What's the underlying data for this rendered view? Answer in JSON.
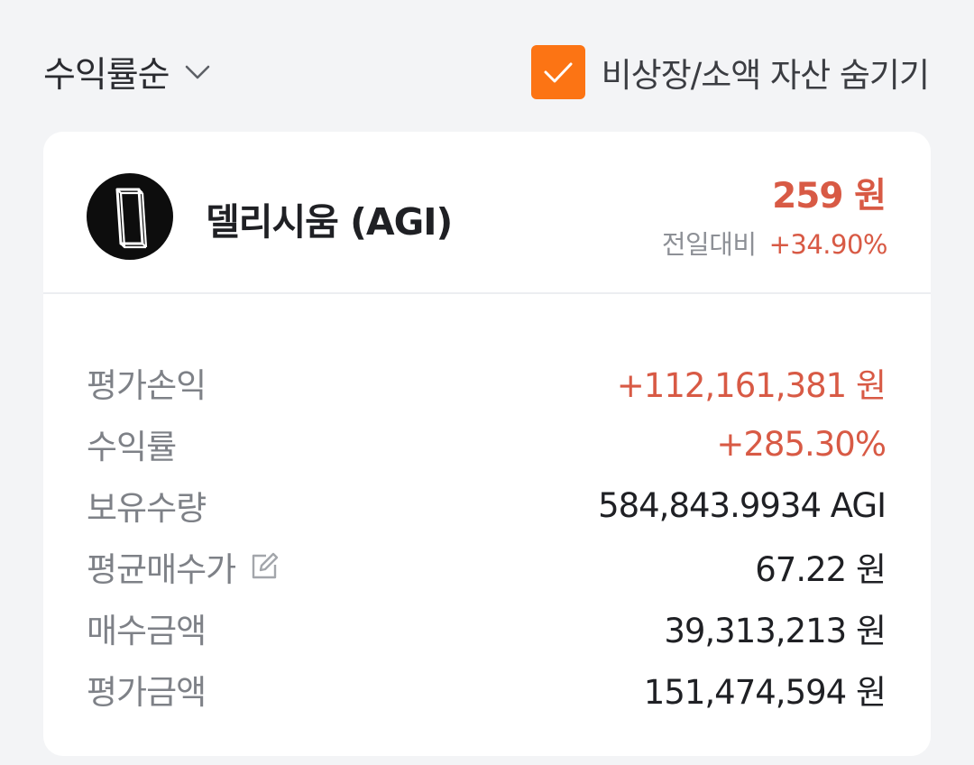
{
  "controls": {
    "sort_label": "수익률순",
    "sort_icon": "chevron-down-icon",
    "hide_label": "비상장/소액 자산 숨기기",
    "hide_checked": true,
    "accent_color": "#fc7414"
  },
  "asset": {
    "name": "델리시움 (AGI)",
    "logo_icon": "delysium-logo",
    "price": "259 원",
    "change_label": "전일대비",
    "change_value": "+34.90%",
    "up_color": "#d85a45"
  },
  "details": [
    {
      "label": "평가손익",
      "value": "+112,161,381 원",
      "highlight": true
    },
    {
      "label": "수익률",
      "value": "+285.30%",
      "highlight": true
    },
    {
      "label": "보유수량",
      "value": "584,843.9934 AGI",
      "highlight": false
    },
    {
      "label": "평균매수가",
      "value": "67.22 원",
      "highlight": false,
      "editable": true
    },
    {
      "label": "매수금액",
      "value": "39,313,213 원",
      "highlight": false
    },
    {
      "label": "평가금액",
      "value": "151,474,594 원",
      "highlight": false
    }
  ]
}
